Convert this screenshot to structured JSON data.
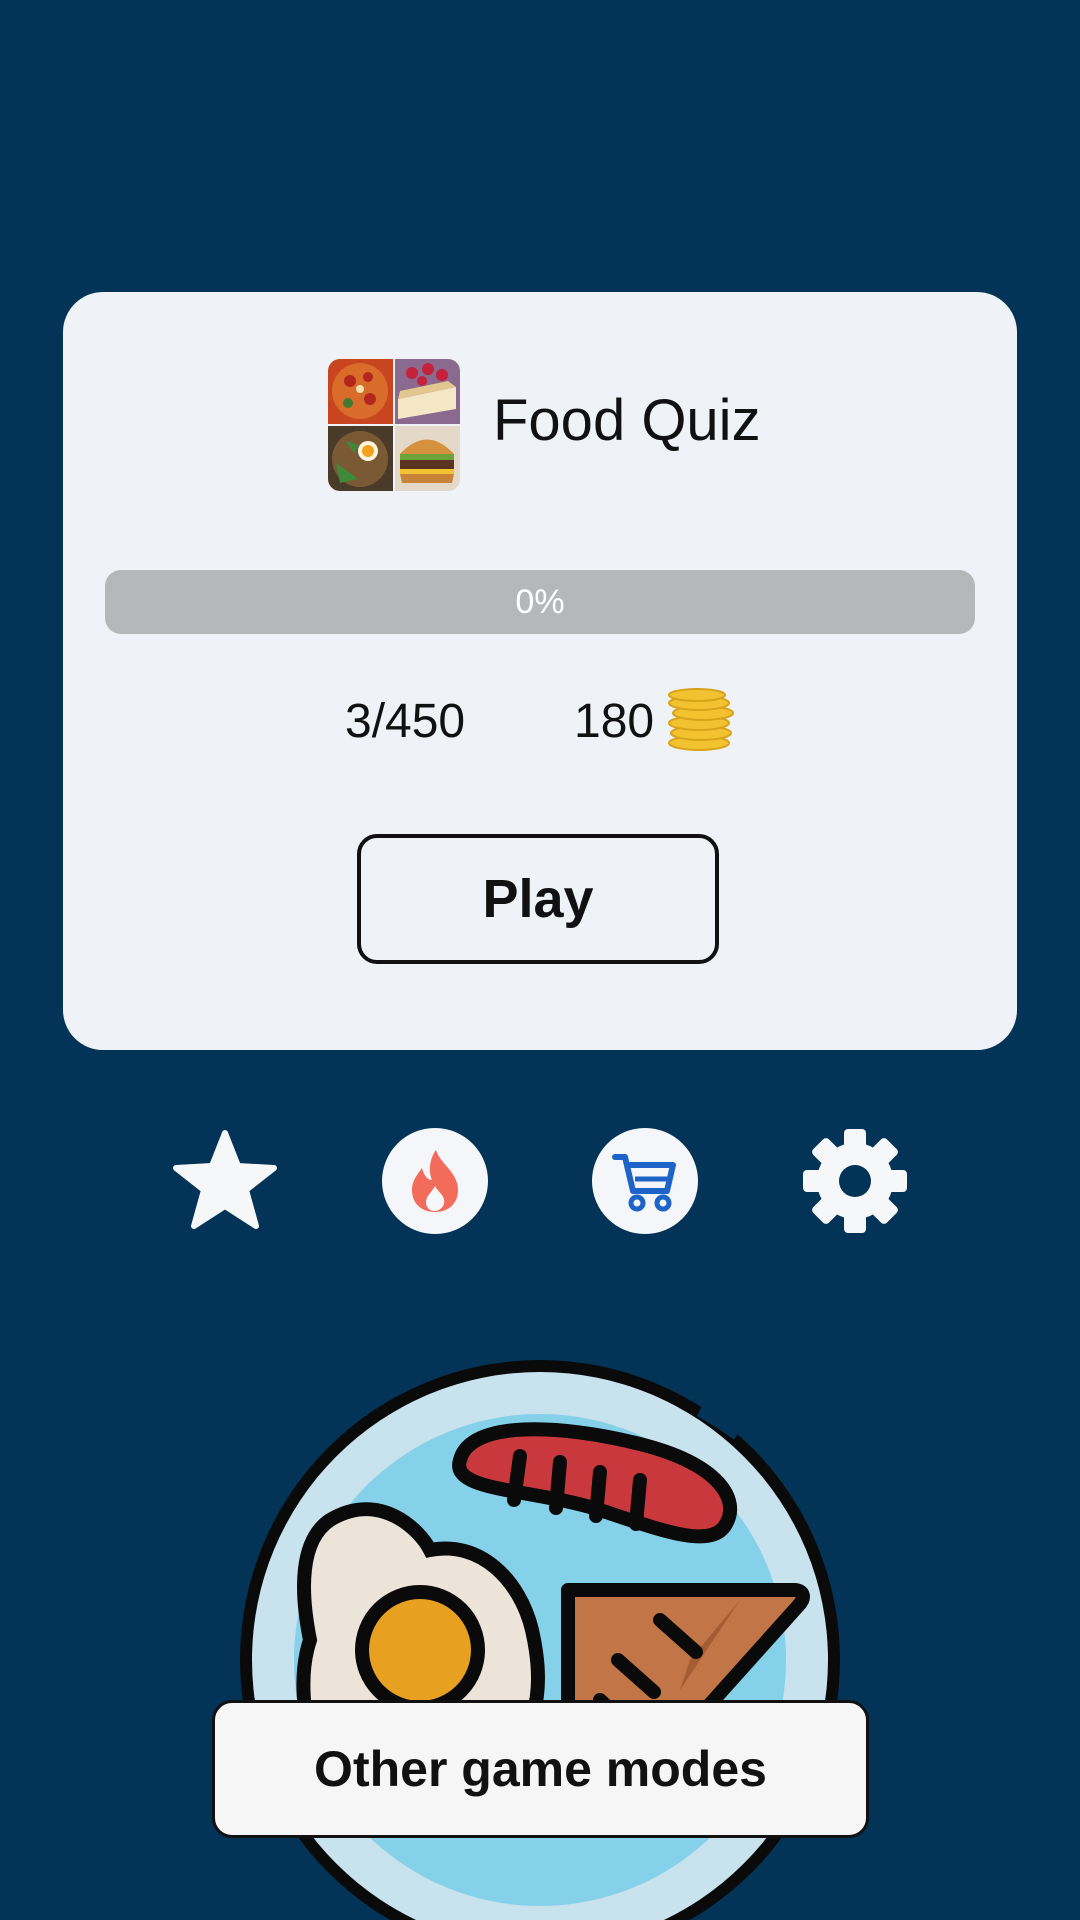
{
  "quiz": {
    "title": "Food Quiz",
    "progress_label": "0%",
    "progress_fraction": 0,
    "count": "3/450",
    "coins": "180"
  },
  "play_label": "Play",
  "toolbar": {
    "icons": [
      "star-icon",
      "flame-icon",
      "cart-icon",
      "gear-icon"
    ]
  },
  "other_modes_label": "Other game modes",
  "colors": {
    "background": "#033357",
    "card": "#eff2f6",
    "progress_track": "#b6b7b9",
    "flame": "#f26b5b",
    "cart": "#1e64c8",
    "coin": "#f2c230"
  }
}
